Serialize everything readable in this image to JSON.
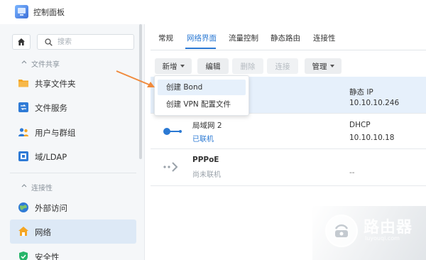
{
  "window": {
    "title": "控制面板"
  },
  "sidebar": {
    "search_placeholder": "搜索",
    "sections": [
      {
        "label": "文件共享"
      },
      {
        "label": "连接性"
      }
    ],
    "items": [
      {
        "label": "共享文件夹",
        "icon": "folder-icon"
      },
      {
        "label": "文件服务",
        "icon": "file-services-icon"
      },
      {
        "label": "用户与群组",
        "icon": "users-icon"
      },
      {
        "label": "域/LDAP",
        "icon": "domain-icon"
      },
      {
        "label": "外部访问",
        "icon": "external-access-icon"
      },
      {
        "label": "网络",
        "icon": "network-icon",
        "active": true
      },
      {
        "label": "安全性",
        "icon": "security-icon"
      }
    ]
  },
  "tabs": [
    {
      "label": "常规"
    },
    {
      "label": "网络界面",
      "active": true
    },
    {
      "label": "流量控制"
    },
    {
      "label": "静态路由"
    },
    {
      "label": "连接性"
    }
  ],
  "toolbar": {
    "new_label": "新增",
    "edit_label": "编辑",
    "delete_label": "删除",
    "connect_label": "连接",
    "manage_label": "管理"
  },
  "dropdown": {
    "items": [
      {
        "label": "创建 Bond"
      },
      {
        "label": "创建 VPN 配置文件"
      }
    ]
  },
  "interfaces": [
    {
      "name": "",
      "status": "",
      "mode": "静态 IP",
      "ip": "10.10.10.246"
    },
    {
      "name": "局域网 2",
      "status": "已联机",
      "mode": "DHCP",
      "ip": "10.10.10.18"
    },
    {
      "name": "PPPoE",
      "status": "尚未联机",
      "mode": "",
      "ip": "--"
    }
  ],
  "watermark": {
    "text": "路由器",
    "sub": "luyouqi.com"
  },
  "colors": {
    "accent": "#2b79d3",
    "arrow": "#f08a3c",
    "selected_row": "#e6f0fb"
  }
}
